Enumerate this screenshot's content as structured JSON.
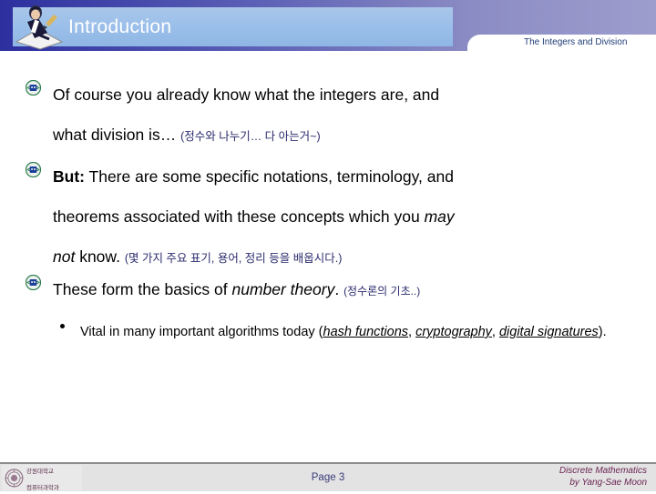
{
  "header": {
    "title": "Introduction",
    "subject": "The Integers and Division",
    "icon_name": "person-writing-icon",
    "band_color_left": "#2c2f9e",
    "band_color_right": "#9d9dcd",
    "title_bar_color": "#9cc0ea",
    "title_text_color": "#ffffff",
    "subject_color": "#1f3d78"
  },
  "bullets": [
    {
      "marker": "emblem-bullet-icon",
      "line1_en": "Of course you already know what the integers are, and",
      "line2_en": "what division is…",
      "line2_kr": "(정수와 나누기… 다 아는거~)"
    },
    {
      "marker": "emblem-bullet-icon",
      "lead": "But:",
      "line1_en": " There are some specific notations, terminology, and",
      "line2_en": "theorems associated with these concepts which you ",
      "line2_em": "may",
      "line3_em": "not",
      "line3_en": " know. ",
      "line3_kr": "(몇 가지 주요 표기, 용어, 정리 등을 배웁시다.)"
    },
    {
      "marker": "emblem-bullet-icon",
      "line1_en": "These form the basics of ",
      "line1_em": "number theory",
      "line1_tail": ". ",
      "line1_kr": "(정수론의 기초..)"
    }
  ],
  "sub_bullet": {
    "marker": "round-bullet",
    "text_a": "Vital in many important algorithms today (",
    "link_1": "hash functions",
    "text_b": ", ",
    "link_2": "cryptography",
    "text_c": ", ",
    "link_3": "digital signatures",
    "text_d": ")."
  },
  "footer": {
    "logo_name": "university-seal-logo",
    "logo_korean_line1": "강원대학교",
    "logo_korean_line2": "컴퓨터과학과",
    "page_label": "Page 3",
    "course_line1": "Discrete Mathematics",
    "course_line2": "by Yang-Sae Moon",
    "band_color": "#e3e3e3",
    "page_color": "#3a3a7a",
    "course_color": "#6b2452"
  }
}
